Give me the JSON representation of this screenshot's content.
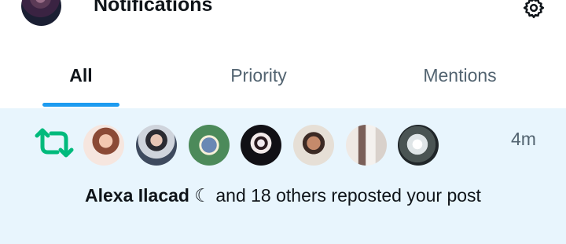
{
  "header": {
    "title": "Notifications",
    "profile_avatar_icon": "profile-avatar",
    "settings_icon": "gear-icon"
  },
  "tabs": [
    {
      "label": "All",
      "active": true
    },
    {
      "label": "Priority",
      "active": false
    },
    {
      "label": "Mentions",
      "active": false
    }
  ],
  "accent_color": "#1d9bf0",
  "notification": {
    "icon": "repost-icon",
    "icon_color": "#00ba7c",
    "highlight_background": "#e8f5fd",
    "timestamp": "4m",
    "user_name": "Alexa Ilacad ☾",
    "message_rest": " and 18 others reposted your post",
    "avatar_count": 7
  }
}
